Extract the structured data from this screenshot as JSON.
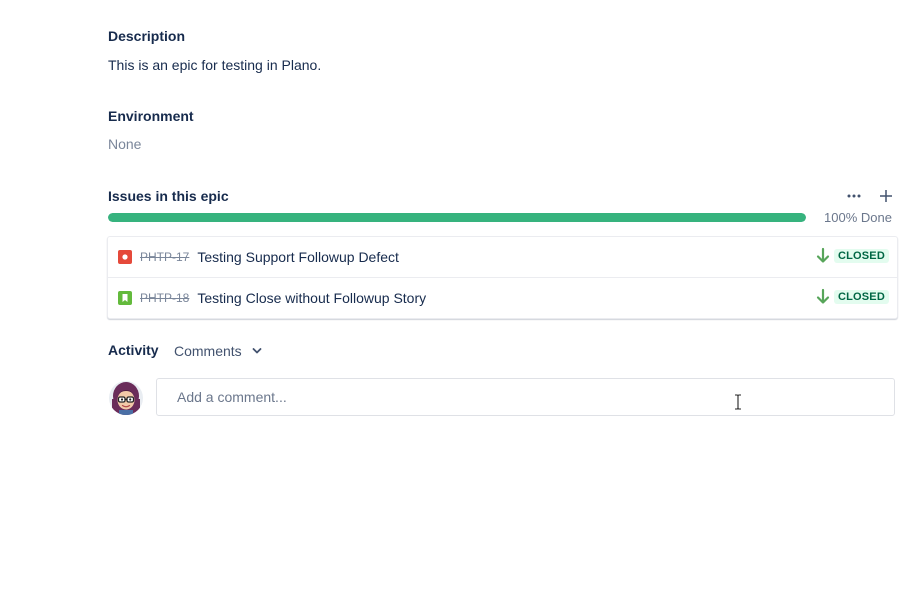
{
  "description": {
    "heading": "Description",
    "text": "This is an epic for testing in Plano."
  },
  "environment": {
    "heading": "Environment",
    "value": "None"
  },
  "epic_issues": {
    "heading": "Issues in this epic",
    "progress_percent": 100,
    "progress_label": "100% Done",
    "progress_color": "#36b37e",
    "actions": [
      {
        "icon": "more-icon"
      },
      {
        "icon": "plus-icon"
      }
    ],
    "issues": [
      {
        "type": "bug",
        "type_icon": "bug-icon",
        "type_color": "#e5493a",
        "key": "PHTP-17",
        "summary": "Testing Support Followup Defect",
        "priority_icon": "priority-low-arrow-icon",
        "priority_color": "#57a55a",
        "status": "CLOSED"
      },
      {
        "type": "story",
        "type_icon": "story-icon",
        "type_color": "#63ba3c",
        "key": "PHTP-18",
        "summary": "Testing Close without Followup Story",
        "priority_icon": "priority-low-arrow-icon",
        "priority_color": "#57a55a",
        "status": "CLOSED"
      }
    ]
  },
  "activity": {
    "label": "Activity",
    "filter_selected": "Comments"
  },
  "comment": {
    "placeholder": "Add a comment..."
  }
}
